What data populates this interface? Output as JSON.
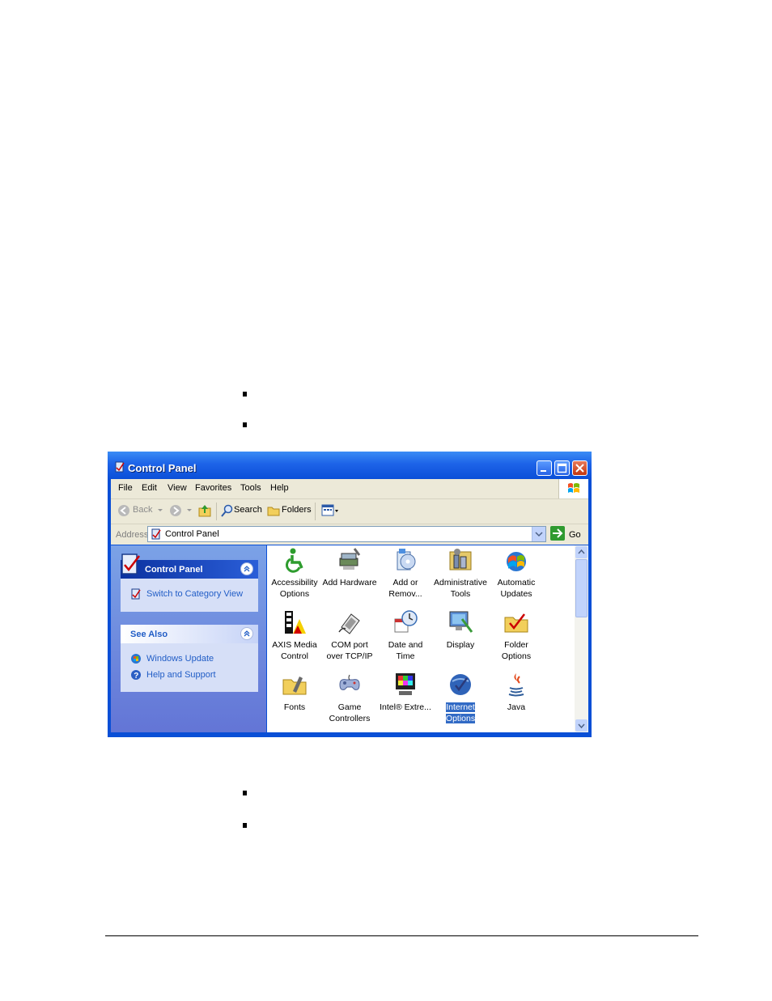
{
  "window": {
    "title": "Control Panel",
    "menu": [
      "File",
      "Edit",
      "View",
      "Favorites",
      "Tools",
      "Help"
    ],
    "toolbar": {
      "back": "Back",
      "search": "Search",
      "folders": "Folders"
    },
    "address": {
      "label": "Address",
      "value": "Control Panel",
      "go": "Go"
    }
  },
  "taskpane": {
    "panel_title": "Control Panel",
    "switch_link": "Switch to Category View",
    "see_also_title": "See Also",
    "see_also_links": [
      "Windows Update",
      "Help and Support"
    ]
  },
  "icons": [
    {
      "label": "Accessibility Options",
      "icon": "accessibility-icon"
    },
    {
      "label": "Add Hardware",
      "icon": "add-hardware-icon"
    },
    {
      "label": "Add or Remov...",
      "icon": "add-remove-programs-icon"
    },
    {
      "label": "Administrative Tools",
      "icon": "administrative-tools-icon"
    },
    {
      "label": "Automatic Updates",
      "icon": "automatic-updates-icon"
    },
    {
      "label": "AXIS Media Control",
      "icon": "axis-media-control-icon"
    },
    {
      "label": "COM port over TCP/IP",
      "icon": "com-port-icon"
    },
    {
      "label": "Date and Time",
      "icon": "date-time-icon"
    },
    {
      "label": "Display",
      "icon": "display-icon"
    },
    {
      "label": "Folder Options",
      "icon": "folder-options-icon"
    },
    {
      "label": "Fonts",
      "icon": "fonts-icon"
    },
    {
      "label": "Game Controllers",
      "icon": "game-controllers-icon"
    },
    {
      "label": "Intel® Extre...",
      "icon": "intel-graphics-icon"
    },
    {
      "label": "Internet Options",
      "icon": "internet-options-icon",
      "selected": true
    },
    {
      "label": "Java",
      "icon": "java-icon"
    }
  ],
  "colors": {
    "title_blue": "#0a4fd6",
    "selection": "#316ac5",
    "link": "#215dc6"
  }
}
